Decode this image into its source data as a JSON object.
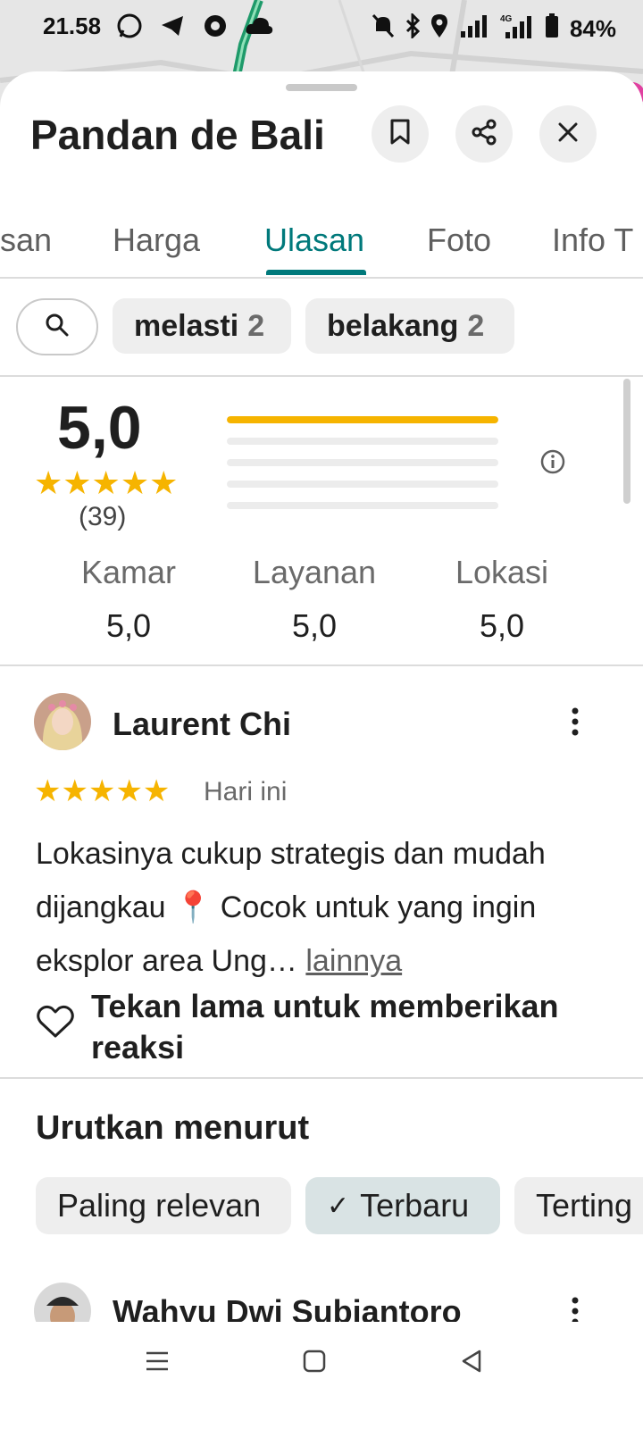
{
  "status_bar": {
    "time": "21.58",
    "battery": "84%"
  },
  "place": {
    "title": "Pandan de Bali"
  },
  "tabs": [
    {
      "label": "san"
    },
    {
      "label": "Harga"
    },
    {
      "label": "Ulasan",
      "active": true
    },
    {
      "label": "Foto"
    },
    {
      "label": "Info T"
    }
  ],
  "filters": {
    "chips": [
      {
        "label": "melasti",
        "count": "2"
      },
      {
        "label": "belakang",
        "count": "2"
      }
    ]
  },
  "summary": {
    "rating": "5,0",
    "stars": "★★★★★",
    "count": "(39)",
    "distribution": [
      {
        "stars": 5,
        "fraction": 1.0
      },
      {
        "stars": 4,
        "fraction": 0
      },
      {
        "stars": 3,
        "fraction": 0
      },
      {
        "stars": 2,
        "fraction": 0
      },
      {
        "stars": 1,
        "fraction": 0
      }
    ],
    "categories": [
      {
        "label": "Kamar",
        "value": "5,0"
      },
      {
        "label": "Layanan",
        "value": "5,0"
      },
      {
        "label": "Lokasi",
        "value": "5,0"
      }
    ]
  },
  "review": {
    "author": "Laurent Chi",
    "stars": "★★★★★",
    "date": "Hari ini",
    "text": "Lokasinya cukup strategis dan mudah dijangkau 📍 Cocok untuk yang ingin eksplor area Ung…",
    "more_label": "lainnya",
    "reaction_hint": "Tekan lama untuk memberikan reaksi"
  },
  "sort": {
    "title": "Urutkan menurut",
    "options": [
      {
        "label": "Paling relevan",
        "selected": false
      },
      {
        "label": "Terbaru",
        "selected": true,
        "check": "✓"
      },
      {
        "label": "Terting",
        "selected": false
      }
    ]
  },
  "next_review": {
    "author": "Wahyu Dwi Subiantoro"
  },
  "colors": {
    "accent": "#00797b",
    "star": "#f6b400",
    "chip_bg": "#eeeeee",
    "selected_chip_bg": "#d9e3e4"
  }
}
